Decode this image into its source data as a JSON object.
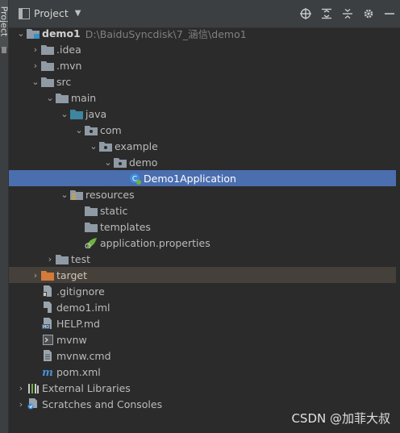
{
  "window": {
    "panel_title": "Project"
  },
  "tree": {
    "root": {
      "label": "demo1",
      "path": "D:\\BaiduSyncdisk\\7_涵信\\demo1"
    },
    "items": [
      {
        "label": ".idea"
      },
      {
        "label": ".mvn"
      },
      {
        "label": "src"
      },
      {
        "label": "main"
      },
      {
        "label": "java"
      },
      {
        "label": "com"
      },
      {
        "label": "example"
      },
      {
        "label": "demo"
      },
      {
        "label": "Demo1Application"
      },
      {
        "label": "resources"
      },
      {
        "label": "static"
      },
      {
        "label": "templates"
      },
      {
        "label": "application.properties"
      },
      {
        "label": "test"
      },
      {
        "label": "target"
      },
      {
        "label": ".gitignore"
      },
      {
        "label": "demo1.iml"
      },
      {
        "label": "HELP.md"
      },
      {
        "label": "mvnw"
      },
      {
        "label": "mvnw.cmd"
      },
      {
        "label": "pom.xml"
      },
      {
        "label": "External Libraries"
      },
      {
        "label": "Scratches and Consoles"
      }
    ]
  },
  "watermark": "CSDN @加菲大叔",
  "colors": {
    "selection": "#4b6eaf",
    "background": "#2b2b2b",
    "target": "#45403a"
  }
}
